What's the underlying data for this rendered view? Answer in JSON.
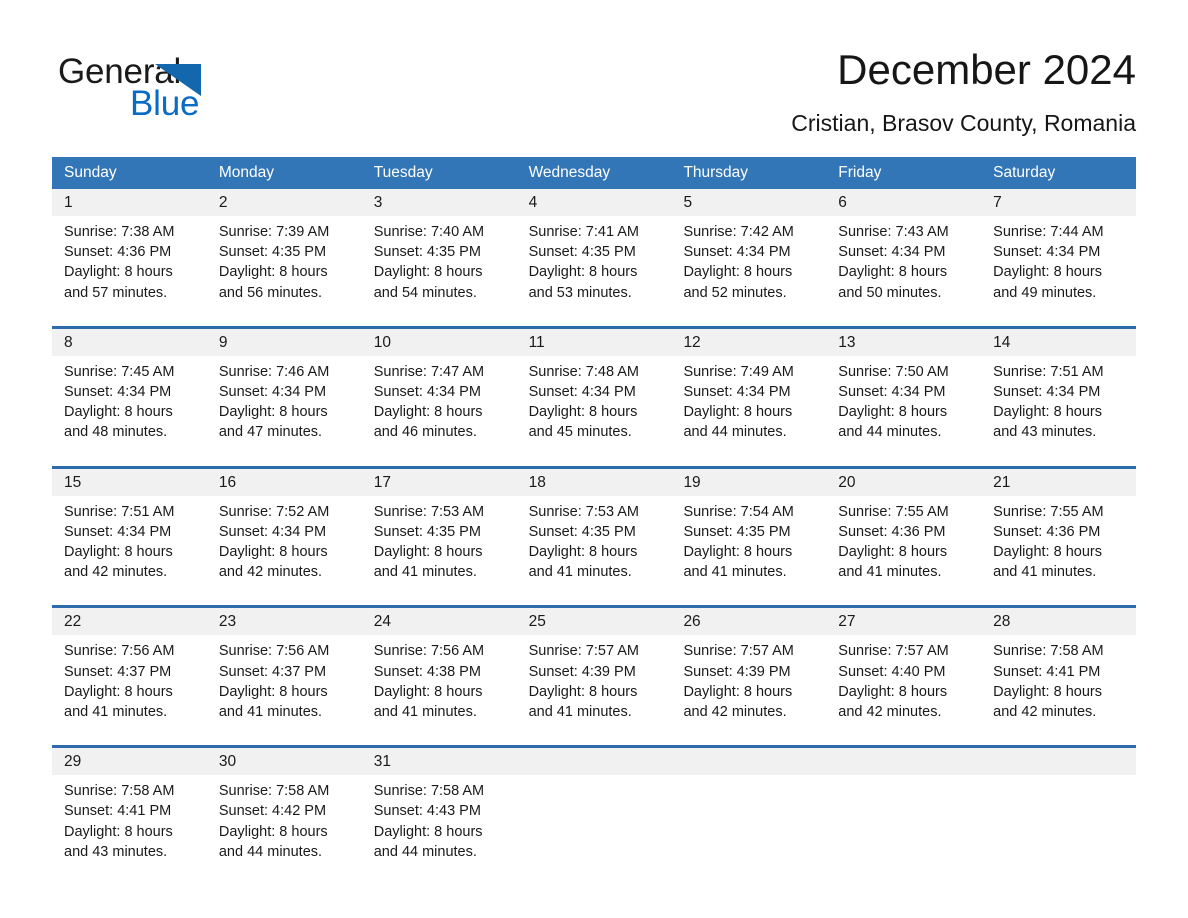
{
  "brand": {
    "word_one": "General",
    "word_two": "Blue",
    "triangle_color": "#1267ad",
    "blue_text_color": "#0a6bc4"
  },
  "header": {
    "title": "December 2024",
    "subtitle": "Cristian, Brasov County, Romania"
  },
  "theme": {
    "header_bg": "#3376b8",
    "week_divider": "#2d6cac",
    "daynum_bg": "#f1f1f1",
    "text": "#1a1a1a"
  },
  "calendar": {
    "day_headers": [
      "Sunday",
      "Monday",
      "Tuesday",
      "Wednesday",
      "Thursday",
      "Friday",
      "Saturday"
    ],
    "weeks": [
      {
        "days": [
          {
            "num": "1",
            "lines": [
              "Sunrise: 7:38 AM",
              "Sunset: 4:36 PM",
              "Daylight: 8 hours",
              "and 57 minutes."
            ]
          },
          {
            "num": "2",
            "lines": [
              "Sunrise: 7:39 AM",
              "Sunset: 4:35 PM",
              "Daylight: 8 hours",
              "and 56 minutes."
            ]
          },
          {
            "num": "3",
            "lines": [
              "Sunrise: 7:40 AM",
              "Sunset: 4:35 PM",
              "Daylight: 8 hours",
              "and 54 minutes."
            ]
          },
          {
            "num": "4",
            "lines": [
              "Sunrise: 7:41 AM",
              "Sunset: 4:35 PM",
              "Daylight: 8 hours",
              "and 53 minutes."
            ]
          },
          {
            "num": "5",
            "lines": [
              "Sunrise: 7:42 AM",
              "Sunset: 4:34 PM",
              "Daylight: 8 hours",
              "and 52 minutes."
            ]
          },
          {
            "num": "6",
            "lines": [
              "Sunrise: 7:43 AM",
              "Sunset: 4:34 PM",
              "Daylight: 8 hours",
              "and 50 minutes."
            ]
          },
          {
            "num": "7",
            "lines": [
              "Sunrise: 7:44 AM",
              "Sunset: 4:34 PM",
              "Daylight: 8 hours",
              "and 49 minutes."
            ]
          }
        ]
      },
      {
        "days": [
          {
            "num": "8",
            "lines": [
              "Sunrise: 7:45 AM",
              "Sunset: 4:34 PM",
              "Daylight: 8 hours",
              "and 48 minutes."
            ]
          },
          {
            "num": "9",
            "lines": [
              "Sunrise: 7:46 AM",
              "Sunset: 4:34 PM",
              "Daylight: 8 hours",
              "and 47 minutes."
            ]
          },
          {
            "num": "10",
            "lines": [
              "Sunrise: 7:47 AM",
              "Sunset: 4:34 PM",
              "Daylight: 8 hours",
              "and 46 minutes."
            ]
          },
          {
            "num": "11",
            "lines": [
              "Sunrise: 7:48 AM",
              "Sunset: 4:34 PM",
              "Daylight: 8 hours",
              "and 45 minutes."
            ]
          },
          {
            "num": "12",
            "lines": [
              "Sunrise: 7:49 AM",
              "Sunset: 4:34 PM",
              "Daylight: 8 hours",
              "and 44 minutes."
            ]
          },
          {
            "num": "13",
            "lines": [
              "Sunrise: 7:50 AM",
              "Sunset: 4:34 PM",
              "Daylight: 8 hours",
              "and 44 minutes."
            ]
          },
          {
            "num": "14",
            "lines": [
              "Sunrise: 7:51 AM",
              "Sunset: 4:34 PM",
              "Daylight: 8 hours",
              "and 43 minutes."
            ]
          }
        ]
      },
      {
        "days": [
          {
            "num": "15",
            "lines": [
              "Sunrise: 7:51 AM",
              "Sunset: 4:34 PM",
              "Daylight: 8 hours",
              "and 42 minutes."
            ]
          },
          {
            "num": "16",
            "lines": [
              "Sunrise: 7:52 AM",
              "Sunset: 4:34 PM",
              "Daylight: 8 hours",
              "and 42 minutes."
            ]
          },
          {
            "num": "17",
            "lines": [
              "Sunrise: 7:53 AM",
              "Sunset: 4:35 PM",
              "Daylight: 8 hours",
              "and 41 minutes."
            ]
          },
          {
            "num": "18",
            "lines": [
              "Sunrise: 7:53 AM",
              "Sunset: 4:35 PM",
              "Daylight: 8 hours",
              "and 41 minutes."
            ]
          },
          {
            "num": "19",
            "lines": [
              "Sunrise: 7:54 AM",
              "Sunset: 4:35 PM",
              "Daylight: 8 hours",
              "and 41 minutes."
            ]
          },
          {
            "num": "20",
            "lines": [
              "Sunrise: 7:55 AM",
              "Sunset: 4:36 PM",
              "Daylight: 8 hours",
              "and 41 minutes."
            ]
          },
          {
            "num": "21",
            "lines": [
              "Sunrise: 7:55 AM",
              "Sunset: 4:36 PM",
              "Daylight: 8 hours",
              "and 41 minutes."
            ]
          }
        ]
      },
      {
        "days": [
          {
            "num": "22",
            "lines": [
              "Sunrise: 7:56 AM",
              "Sunset: 4:37 PM",
              "Daylight: 8 hours",
              "and 41 minutes."
            ]
          },
          {
            "num": "23",
            "lines": [
              "Sunrise: 7:56 AM",
              "Sunset: 4:37 PM",
              "Daylight: 8 hours",
              "and 41 minutes."
            ]
          },
          {
            "num": "24",
            "lines": [
              "Sunrise: 7:56 AM",
              "Sunset: 4:38 PM",
              "Daylight: 8 hours",
              "and 41 minutes."
            ]
          },
          {
            "num": "25",
            "lines": [
              "Sunrise: 7:57 AM",
              "Sunset: 4:39 PM",
              "Daylight: 8 hours",
              "and 41 minutes."
            ]
          },
          {
            "num": "26",
            "lines": [
              "Sunrise: 7:57 AM",
              "Sunset: 4:39 PM",
              "Daylight: 8 hours",
              "and 42 minutes."
            ]
          },
          {
            "num": "27",
            "lines": [
              "Sunrise: 7:57 AM",
              "Sunset: 4:40 PM",
              "Daylight: 8 hours",
              "and 42 minutes."
            ]
          },
          {
            "num": "28",
            "lines": [
              "Sunrise: 7:58 AM",
              "Sunset: 4:41 PM",
              "Daylight: 8 hours",
              "and 42 minutes."
            ]
          }
        ]
      },
      {
        "days": [
          {
            "num": "29",
            "lines": [
              "Sunrise: 7:58 AM",
              "Sunset: 4:41 PM",
              "Daylight: 8 hours",
              "and 43 minutes."
            ]
          },
          {
            "num": "30",
            "lines": [
              "Sunrise: 7:58 AM",
              "Sunset: 4:42 PM",
              "Daylight: 8 hours",
              "and 44 minutes."
            ]
          },
          {
            "num": "31",
            "lines": [
              "Sunrise: 7:58 AM",
              "Sunset: 4:43 PM",
              "Daylight: 8 hours",
              "and 44 minutes."
            ]
          },
          {
            "num": "",
            "lines": []
          },
          {
            "num": "",
            "lines": []
          },
          {
            "num": "",
            "lines": []
          },
          {
            "num": "",
            "lines": []
          }
        ]
      }
    ]
  }
}
